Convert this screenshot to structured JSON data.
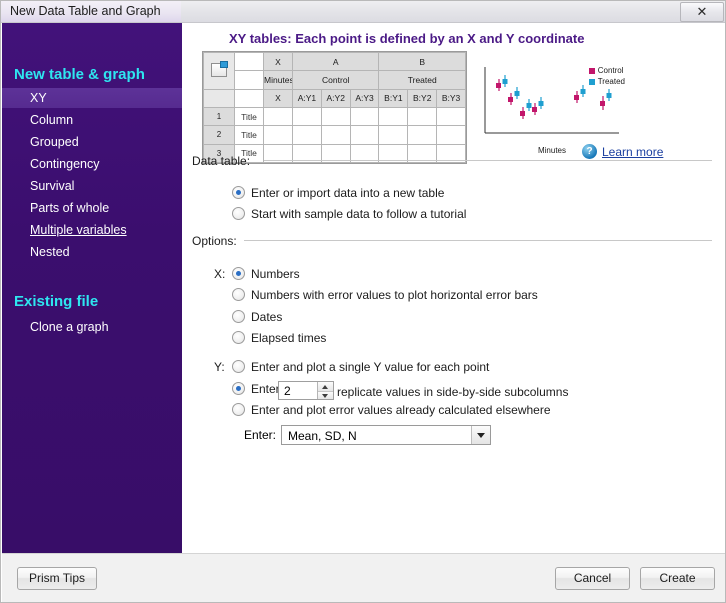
{
  "window": {
    "title": "New Data Table and Graph",
    "close_label": "✕"
  },
  "sidebar": {
    "header_new": "New table & graph",
    "header_existing": "Existing file",
    "items": [
      {
        "label": "XY",
        "selected": true
      },
      {
        "label": "Column",
        "selected": false
      },
      {
        "label": "Grouped",
        "selected": false
      },
      {
        "label": "Contingency",
        "selected": false
      },
      {
        "label": "Survival",
        "selected": false
      },
      {
        "label": "Parts of whole",
        "selected": false
      },
      {
        "label": "Multiple variables",
        "selected": false,
        "underline": true
      },
      {
        "label": "Nested",
        "selected": false
      }
    ],
    "existing_items": [
      {
        "label": "Clone a graph"
      }
    ]
  },
  "panel": {
    "title": "XY tables: Each point is defined by an X and Y coordinate",
    "learn_more": "Learn more",
    "help_icon_glyph": "?"
  },
  "preview_table": {
    "col_group_headers": [
      "X",
      "A",
      "B"
    ],
    "col_group_subheaders": [
      "Minutes",
      "Control",
      "Treated"
    ],
    "col_headers": [
      "X",
      "A:Y1",
      "A:Y2",
      "A:Y3",
      "B:Y1",
      "B:Y2",
      "B:Y3"
    ],
    "rows": [
      {
        "num": "1",
        "label": "Title"
      },
      {
        "num": "2",
        "label": "Title"
      },
      {
        "num": "3",
        "label": "Title"
      }
    ]
  },
  "preview_graph": {
    "legend": [
      {
        "label": "Control",
        "color": "#c2166b"
      },
      {
        "label": "Treated",
        "color": "#1f9fd0"
      }
    ],
    "xlabel": "Minutes"
  },
  "sections": {
    "data_table_label": "Data table:",
    "options_label": "Options:"
  },
  "data_table_options": [
    {
      "label": "Enter or import data into a new table",
      "checked": true
    },
    {
      "label": "Start with sample data to follow a tutorial",
      "checked": false
    }
  ],
  "x_options": {
    "prefix": "X:",
    "items": [
      {
        "label": "Numbers",
        "checked": true
      },
      {
        "label": "Numbers with error values to plot horizontal error bars",
        "checked": false
      },
      {
        "label": "Dates",
        "checked": false
      },
      {
        "label": "Elapsed times",
        "checked": false
      }
    ]
  },
  "y_options": {
    "prefix": "Y:",
    "items": [
      {
        "label": "Enter and plot a single Y value for each point",
        "checked": false
      },
      {
        "label": "Enter",
        "checked": true,
        "suffix": "replicate values in side-by-side subcolumns",
        "value": "2"
      },
      {
        "label": "Enter and plot error values already calculated elsewhere",
        "checked": false
      }
    ],
    "enter_label": "Enter:",
    "enter_selected": "Mean, SD, N"
  },
  "footer": {
    "prism_tips": "Prism Tips",
    "cancel": "Cancel",
    "create": "Create"
  }
}
